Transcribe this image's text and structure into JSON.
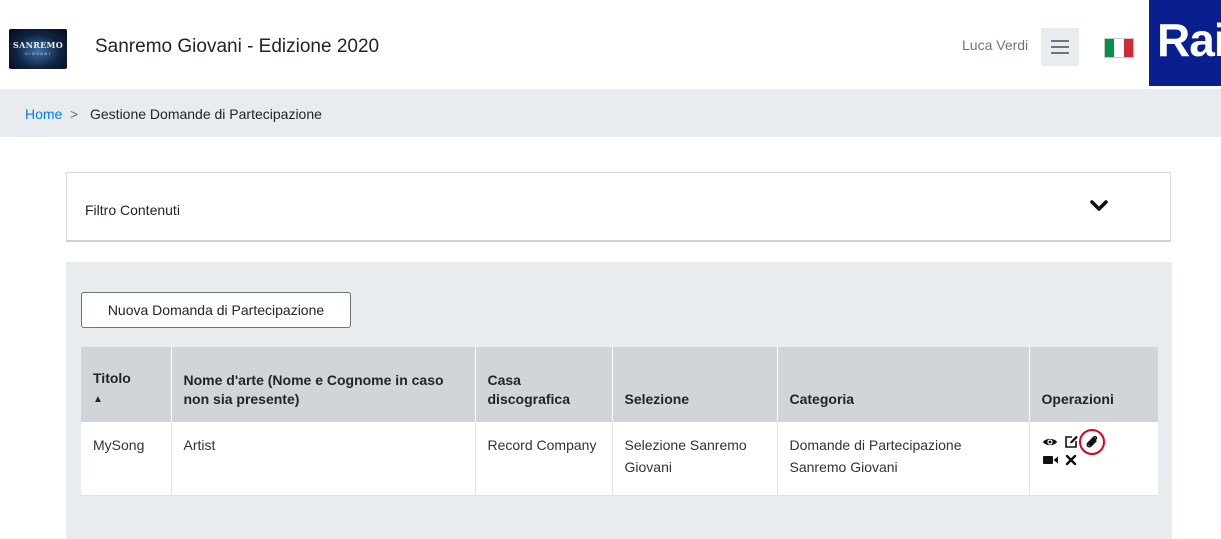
{
  "header": {
    "app_title": "Sanremo Giovani - Edizione 2020",
    "logo_text": "SANREMO",
    "logo_subtext": "GIOVANI",
    "user_name": "Luca Verdi",
    "language_flag": "it-flag-icon",
    "brand_logo_text": "Rai",
    "brand_color": "#0a1f8f"
  },
  "breadcrumb": {
    "home": "Home",
    "separator": ">",
    "current": "Gestione Domande di Partecipazione"
  },
  "filter": {
    "label": "Filtro Contenuti",
    "icon": "chevron-down-icon"
  },
  "actions": {
    "new_application": "Nuova Domanda di Partecipazione"
  },
  "table": {
    "columns": [
      {
        "label": "Titolo",
        "sort_indicator": "▲"
      },
      {
        "label": "Nome d'arte (Nome e Cognome in caso non sia presente)"
      },
      {
        "label": "Casa discografica"
      },
      {
        "label": "Selezione"
      },
      {
        "label": "Categoria"
      },
      {
        "label": "Operazioni"
      }
    ],
    "rows": [
      {
        "titolo": "MySong",
        "nome_arte": "Artist",
        "casa_discografica": "Record Company",
        "selezione": "Selezione Sanremo Giovani",
        "categoria": "Domande di Partecipazione Sanremo Giovani",
        "operations": [
          "eye-icon",
          "edit-icon",
          "paperclip-icon",
          "video-camera-icon",
          "delete-x-icon"
        ]
      }
    ]
  },
  "colors": {
    "link": "#007bff",
    "highlight_circle": "#e0001b",
    "panel_bg": "#e9ecef",
    "table_header_bg": "#d1d4d8"
  }
}
